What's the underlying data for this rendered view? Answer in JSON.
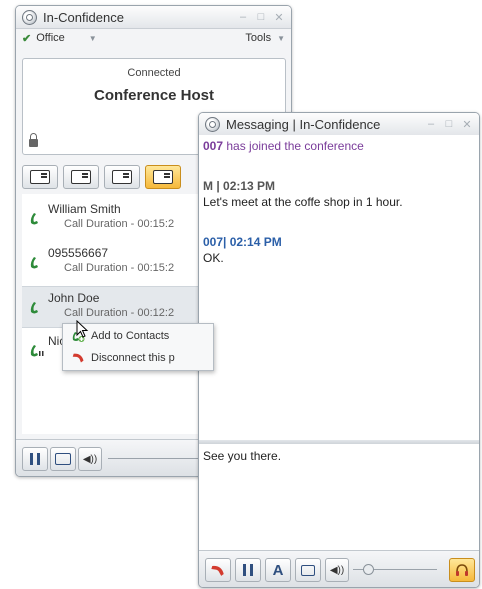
{
  "main_window": {
    "title": "In-Confidence",
    "menu": {
      "office": "Office",
      "tools": "Tools"
    },
    "status": {
      "state": "Connected",
      "host": "Conference Host"
    },
    "calls": [
      {
        "name": "William Smith",
        "duration": "Call Duration - 00:15:2"
      },
      {
        "name": "095556667",
        "duration": "Call Duration - 00:15:2"
      },
      {
        "name": "John Doe",
        "duration": "Call Duration - 00:12:2"
      },
      {
        "name": "Nicc",
        "duration": ""
      }
    ],
    "context_menu": {
      "add": "Add to Contacts",
      "disconnect": "Disconnect this p"
    }
  },
  "messaging_window": {
    "title": "Messaging | In-Confidence",
    "log": {
      "join_sender": "007",
      "join_text": " has joined the conference",
      "msg1_head": "M | 02:13 PM",
      "msg1_body": "Let's meet at the coffe shop in 1 hour.",
      "msg2_head": "007| 02:14 PM",
      "msg2_body": "OK."
    },
    "compose_text": "See you there."
  },
  "colors": {
    "accent": "#f6b93b",
    "system": "#7a3c9a",
    "link": "#2b5fa8",
    "phone": "#2e8b3a",
    "hangup": "#d33b2f"
  }
}
